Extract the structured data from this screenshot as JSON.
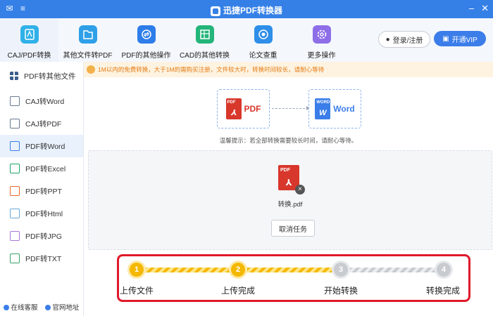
{
  "app": {
    "title": "迅捷PDF转换器"
  },
  "toolbar": {
    "tabs": [
      {
        "label": "CAJ/PDF转换",
        "icon": "caj-pdf-icon"
      },
      {
        "label": "其他文件转PDF",
        "icon": "file-to-pdf-icon"
      },
      {
        "label": "PDF的其他操作",
        "icon": "pdf-ops-icon"
      },
      {
        "label": "CAD的其他转换",
        "icon": "cad-convert-icon"
      },
      {
        "label": "论文查重",
        "icon": "plagiarism-check-icon"
      },
      {
        "label": "更多操作",
        "icon": "settings-gear-icon"
      }
    ],
    "login_label": "登录/注册",
    "vip_label": "开通VIP"
  },
  "sidebar": {
    "items": [
      {
        "label": "PDF转其他文件"
      },
      {
        "label": "CAJ转Word"
      },
      {
        "label": "CAJ转PDF"
      },
      {
        "label": "PDF转Word"
      },
      {
        "label": "PDF转Excel"
      },
      {
        "label": "PDF转PPT"
      },
      {
        "label": "PDF转Html"
      },
      {
        "label": "PDF转JPG"
      },
      {
        "label": "PDF转TXT"
      }
    ],
    "footer": {
      "service_label": "在线客服",
      "website_label": "官网地址"
    }
  },
  "main": {
    "notice": "1M以内的免费转换，大于1M的需购买注册，文件较大时，转换时间较长，请耐心等待",
    "from_format": "PDF",
    "to_format": "Word",
    "from_tag": "PDF",
    "to_tag": "WORD",
    "tip": "温馨提示：若全部转换需要较长时间，请耐心等待。",
    "file": {
      "tag": "PDF",
      "name": "转换.pdf"
    },
    "cancel_label": "取消任务",
    "progress": {
      "steps": [
        {
          "num": "1",
          "label": "上传文件",
          "status": "done"
        },
        {
          "num": "2",
          "label": "上传完成",
          "status": "done"
        },
        {
          "num": "3",
          "label": "开始转换",
          "status": "pending"
        },
        {
          "num": "4",
          "label": "转换完成",
          "status": "pending"
        }
      ]
    }
  },
  "colors": {
    "accent": "#3580e6",
    "notice": "#e57b14",
    "highlight": "#e0192a",
    "progress": "#f5b800"
  }
}
